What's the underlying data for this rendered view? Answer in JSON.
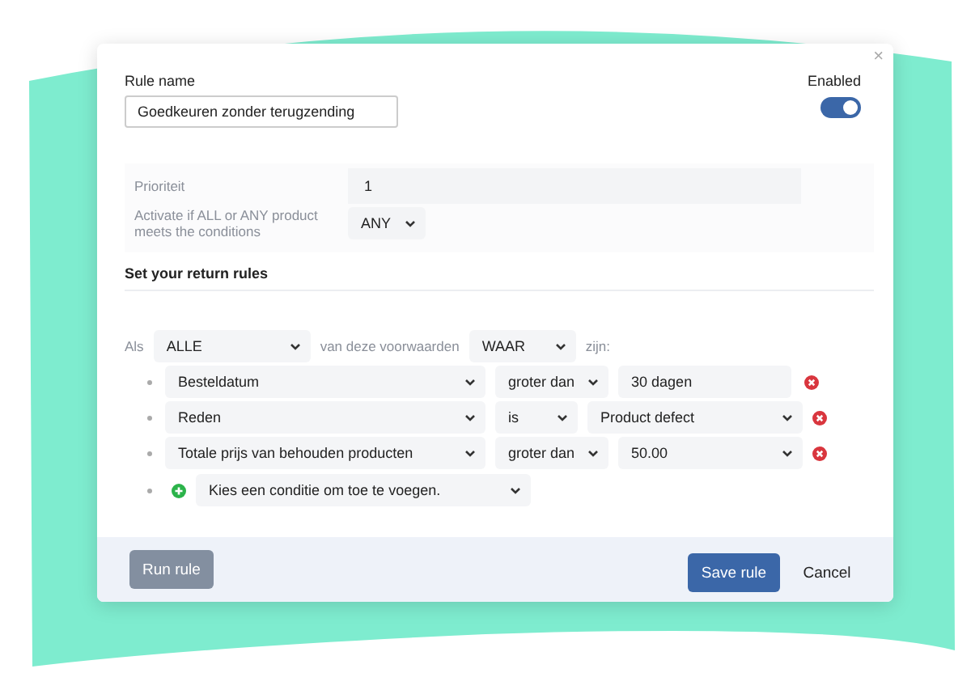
{
  "dialog": {
    "close": "×"
  },
  "rule_name": {
    "label": "Rule name",
    "value": "Goedkeuren zonder terugzending"
  },
  "enabled": {
    "label": "Enabled",
    "on": true
  },
  "priority": {
    "label": "Prioriteit",
    "value": "1"
  },
  "activate": {
    "label": "Activate if ALL or ANY product meets the conditions",
    "value": "ANY"
  },
  "section_title": "Set your return rules",
  "conditions_header": {
    "prefix": "Als",
    "match": "ALLE",
    "middle": "van deze voorwaarden",
    "truth": "WAAR",
    "suffix": "zijn:"
  },
  "conditions": [
    {
      "field": "Besteldatum",
      "operator": "groter dan",
      "value": "30 dagen",
      "kind": "input"
    },
    {
      "field": "Reden",
      "operator": "is",
      "value": "Product defect",
      "kind": "select"
    },
    {
      "field": "Totale prijs van behouden producten",
      "operator": "groter dan",
      "value": "50.00",
      "kind": "select"
    }
  ],
  "add_condition": {
    "value": "Kies een conditie om toe te voegen."
  },
  "buttons": {
    "run": "Run rule",
    "save": "Save rule",
    "cancel": "Cancel"
  }
}
